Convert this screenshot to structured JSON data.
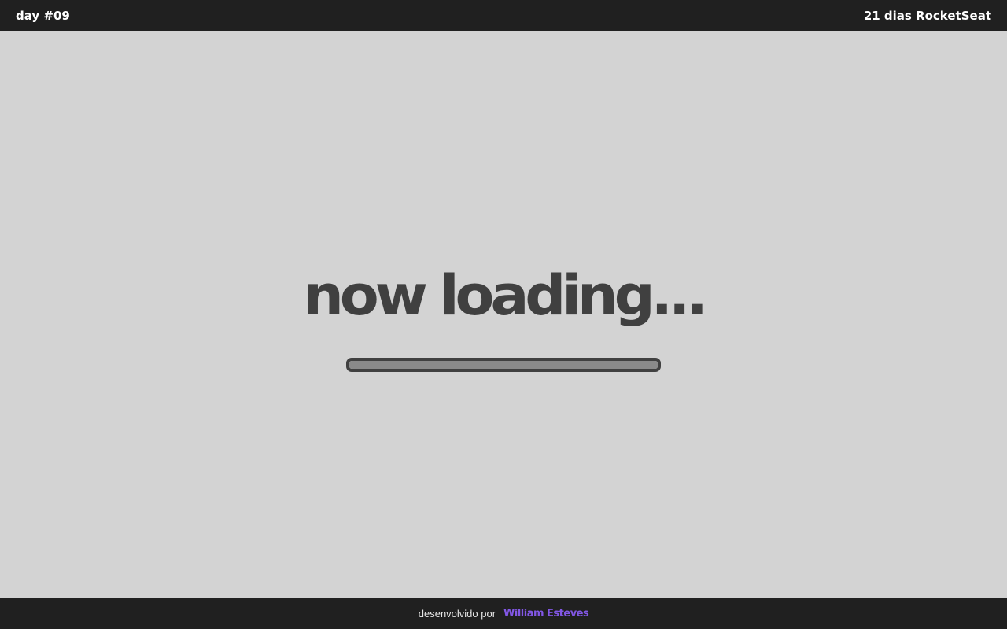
{
  "header": {
    "day_label": "day #09",
    "brand_label": "21 dias RocketSeat"
  },
  "main": {
    "title": "now loading...",
    "progress": 1.0
  },
  "footer": {
    "credit_text": "desenvolvido por",
    "author_name": "William Esteves"
  },
  "colors": {
    "bar_background": "#202020",
    "page_background": "#d3d3d3",
    "title_text": "#404040",
    "progress_border": "#404040",
    "progress_fill": "#8a8a8a",
    "author_link": "#8257e5"
  }
}
